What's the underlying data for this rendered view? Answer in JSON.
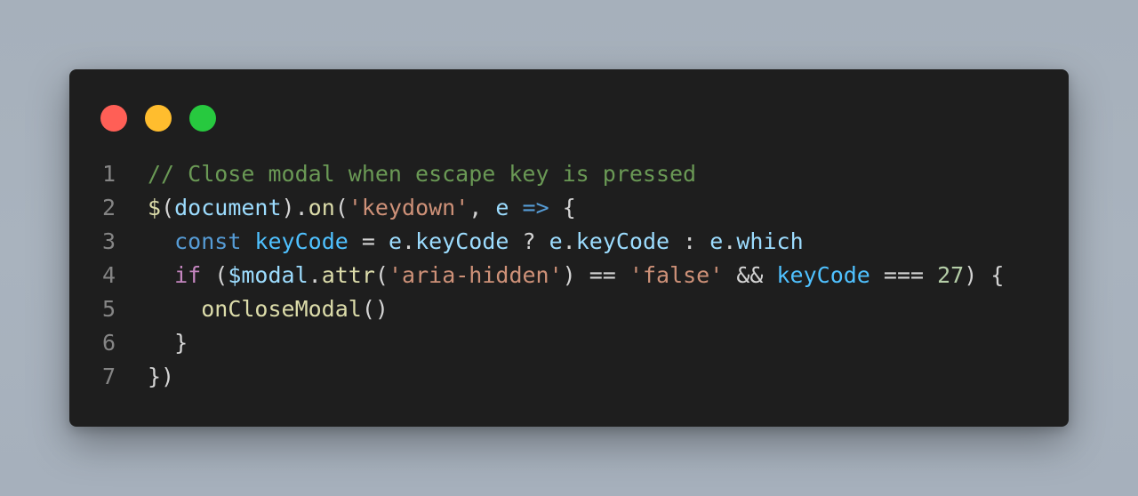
{
  "window": {
    "controls": [
      {
        "name": "close",
        "color": "#ff5f56"
      },
      {
        "name": "minimize",
        "color": "#ffbd2e"
      },
      {
        "name": "maximize",
        "color": "#27c93f"
      }
    ]
  },
  "colors": {
    "editor_background": "#1e1e1e",
    "page_background": "#a8b2bd",
    "line_number": "#858585",
    "comment": "#6a9955",
    "function": "#dcdcaa",
    "variable": "#9cdcfe",
    "string": "#ce9178",
    "keyword": "#569cd6",
    "control": "#c586c0",
    "number": "#b5cea8",
    "constant": "#4fc1ff",
    "punctuation": "#d4d4d4"
  },
  "code": {
    "lines": [
      {
        "number": "1",
        "tokens": [
          {
            "t": "// Close modal when escape key is pressed",
            "c": "comment"
          }
        ]
      },
      {
        "number": "2",
        "tokens": [
          {
            "t": "$",
            "c": "fn"
          },
          {
            "t": "(",
            "c": "punc"
          },
          {
            "t": "document",
            "c": "var"
          },
          {
            "t": ").",
            "c": "punc"
          },
          {
            "t": "on",
            "c": "fn"
          },
          {
            "t": "(",
            "c": "punc"
          },
          {
            "t": "'keydown'",
            "c": "str"
          },
          {
            "t": ", ",
            "c": "punc"
          },
          {
            "t": "e",
            "c": "var"
          },
          {
            "t": " ",
            "c": "punc"
          },
          {
            "t": "=>",
            "c": "kw"
          },
          {
            "t": " {",
            "c": "punc"
          }
        ]
      },
      {
        "number": "3",
        "tokens": [
          {
            "t": "  ",
            "c": "punc"
          },
          {
            "t": "const",
            "c": "kw"
          },
          {
            "t": " ",
            "c": "punc"
          },
          {
            "t": "keyCode",
            "c": "const"
          },
          {
            "t": " = ",
            "c": "punc"
          },
          {
            "t": "e",
            "c": "var"
          },
          {
            "t": ".",
            "c": "punc"
          },
          {
            "t": "keyCode",
            "c": "var"
          },
          {
            "t": " ? ",
            "c": "punc"
          },
          {
            "t": "e",
            "c": "var"
          },
          {
            "t": ".",
            "c": "punc"
          },
          {
            "t": "keyCode",
            "c": "var"
          },
          {
            "t": " : ",
            "c": "punc"
          },
          {
            "t": "e",
            "c": "var"
          },
          {
            "t": ".",
            "c": "punc"
          },
          {
            "t": "which",
            "c": "var"
          }
        ]
      },
      {
        "number": "4",
        "tokens": [
          {
            "t": "  ",
            "c": "punc"
          },
          {
            "t": "if",
            "c": "ctrl"
          },
          {
            "t": " (",
            "c": "punc"
          },
          {
            "t": "$modal",
            "c": "var"
          },
          {
            "t": ".",
            "c": "punc"
          },
          {
            "t": "attr",
            "c": "fn"
          },
          {
            "t": "(",
            "c": "punc"
          },
          {
            "t": "'aria-hidden'",
            "c": "str"
          },
          {
            "t": ") == ",
            "c": "punc"
          },
          {
            "t": "'false'",
            "c": "str"
          },
          {
            "t": " && ",
            "c": "punc"
          },
          {
            "t": "keyCode",
            "c": "const"
          },
          {
            "t": " === ",
            "c": "punc"
          },
          {
            "t": "27",
            "c": "num"
          },
          {
            "t": ") {",
            "c": "punc"
          }
        ]
      },
      {
        "number": "5",
        "tokens": [
          {
            "t": "    ",
            "c": "punc"
          },
          {
            "t": "onCloseModal",
            "c": "fn"
          },
          {
            "t": "()",
            "c": "punc"
          }
        ]
      },
      {
        "number": "6",
        "tokens": [
          {
            "t": "  }",
            "c": "punc"
          }
        ]
      },
      {
        "number": "7",
        "tokens": [
          {
            "t": "})",
            "c": "punc"
          }
        ]
      }
    ]
  }
}
